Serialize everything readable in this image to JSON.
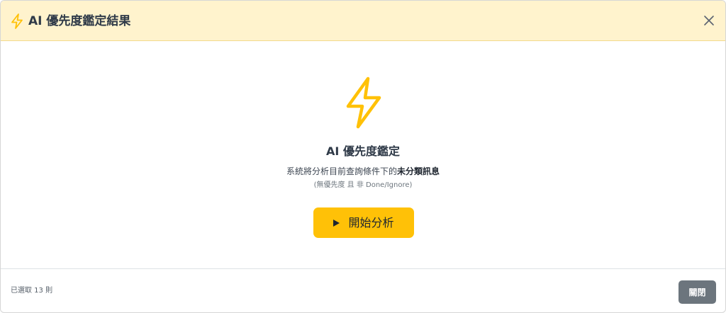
{
  "header": {
    "title": "AI 優先度鑑定結果",
    "icon": "lightning-bolt-icon",
    "close_icon": "close-icon"
  },
  "body": {
    "icon": "lightning-bolt-icon",
    "title": "AI 優先度鑑定",
    "description_prefix": "系統將分析目前查詢條件下的",
    "description_emphasis": "未分類訊息",
    "note": "(無優先度 且 非 Done/Ignore)",
    "start_button_label": "開始分析",
    "start_button_icon": "play-icon"
  },
  "footer": {
    "selected_count": "已選取 13 則",
    "close_button_label": "關閉"
  },
  "colors": {
    "accent": "#ffc107",
    "header_bg": "#fff3cd",
    "secondary_button": "#6c757d"
  }
}
